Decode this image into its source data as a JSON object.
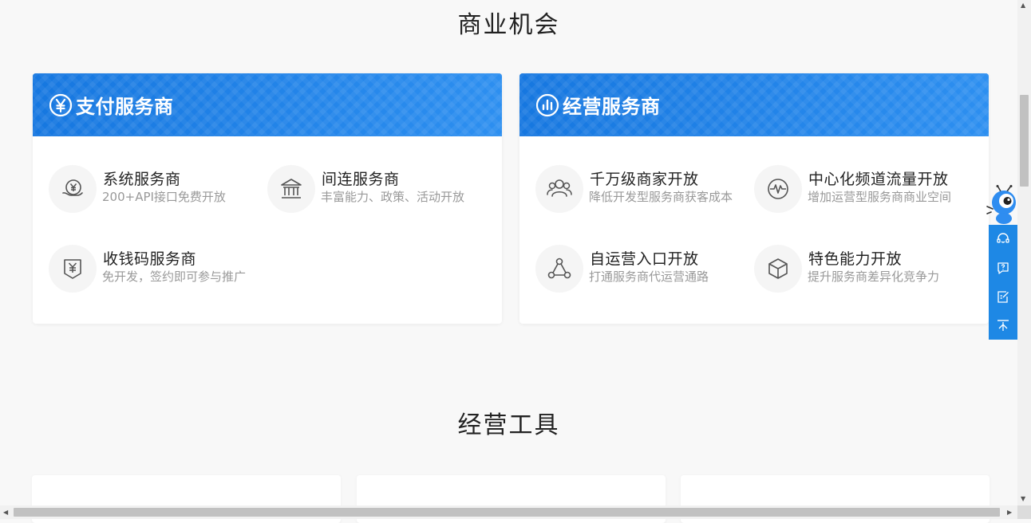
{
  "sections": {
    "opportunity_title": "商业机会",
    "tools_title": "经营工具"
  },
  "cards": [
    {
      "title": "支付服务商",
      "icon": "yen-circle-icon",
      "items": [
        {
          "title": "系统服务商",
          "desc": "200+API接口免费开放",
          "icon": "yen-coin-hand-icon"
        },
        {
          "title": "间连服务商",
          "desc": "丰富能力、政策、活动开放",
          "icon": "bank-icon"
        },
        {
          "title": "收钱码服务商",
          "desc": "免开发，签约即可参与推广",
          "icon": "yen-code-icon"
        }
      ]
    },
    {
      "title": "经营服务商",
      "icon": "bar-chart-circle-icon",
      "items": [
        {
          "title": "千万级商家开放",
          "desc": "降低开发型服务商获客成本",
          "icon": "users-icon"
        },
        {
          "title": "中心化频道流量开放",
          "desc": "增加运营型服务商商业空间",
          "icon": "pulse-icon"
        },
        {
          "title": "自运营入口开放",
          "desc": "打通服务商代运营通路",
          "icon": "network-icon"
        },
        {
          "title": "特色能力开放",
          "desc": "提升服务商差异化竞争力",
          "icon": "cube-icon"
        }
      ]
    }
  ],
  "float_bar": {
    "buttons": [
      "customer-service-icon",
      "help-icon",
      "feedback-icon",
      "back-to-top-icon"
    ]
  },
  "colors": {
    "brand_blue": "#1a80e6",
    "float_bar": "#1e88e5",
    "desc_gray": "#999999"
  }
}
